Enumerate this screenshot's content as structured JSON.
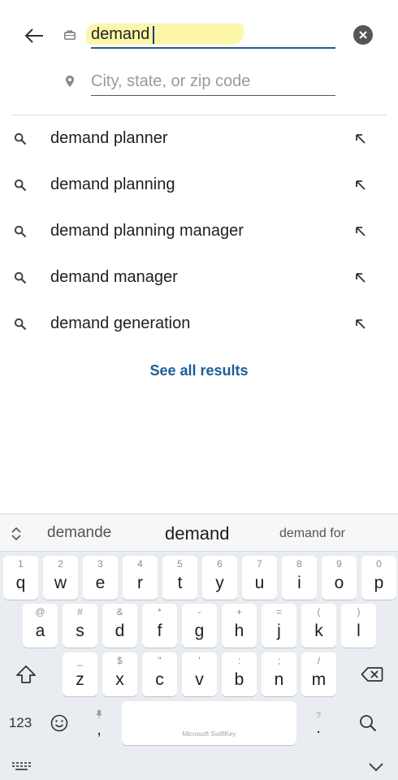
{
  "search": {
    "keyword_value": "demand",
    "location_placeholder": "City, state, or zip code"
  },
  "suggestions": [
    {
      "label": "demand planner"
    },
    {
      "label": "demand planning"
    },
    {
      "label": "demand planning manager"
    },
    {
      "label": "demand manager"
    },
    {
      "label": "demand generation"
    }
  ],
  "see_all_label": "See all results",
  "keyboard": {
    "predictions": [
      "demande",
      "demand",
      "demand for"
    ],
    "row1": [
      {
        "hint": "1",
        "ch": "q"
      },
      {
        "hint": "2",
        "ch": "w"
      },
      {
        "hint": "3",
        "ch": "e"
      },
      {
        "hint": "4",
        "ch": "r"
      },
      {
        "hint": "5",
        "ch": "t"
      },
      {
        "hint": "6",
        "ch": "y"
      },
      {
        "hint": "7",
        "ch": "u"
      },
      {
        "hint": "8",
        "ch": "i"
      },
      {
        "hint": "9",
        "ch": "o"
      },
      {
        "hint": "0",
        "ch": "p"
      }
    ],
    "row2": [
      {
        "hint": "@",
        "ch": "a"
      },
      {
        "hint": "#",
        "ch": "s"
      },
      {
        "hint": "&",
        "ch": "d"
      },
      {
        "hint": "*",
        "ch": "f"
      },
      {
        "hint": "-",
        "ch": "g"
      },
      {
        "hint": "+",
        "ch": "h"
      },
      {
        "hint": "=",
        "ch": "j"
      },
      {
        "hint": "(",
        "ch": "k"
      },
      {
        "hint": ")",
        "ch": "l"
      }
    ],
    "row3": [
      {
        "hint": "_",
        "ch": "z"
      },
      {
        "hint": "$",
        "ch": "x"
      },
      {
        "hint": "\"",
        "ch": "c"
      },
      {
        "hint": "'",
        "ch": "v"
      },
      {
        "hint": ":",
        "ch": "b"
      },
      {
        "hint": ";",
        "ch": "n"
      },
      {
        "hint": "/",
        "ch": "m"
      }
    ],
    "numbers_label": "123",
    "comma": ",",
    "period": ".",
    "comma_hint_icon": "microphone-icon",
    "period_hint": "?",
    "space_brand": "Microsoft SwiftKey"
  },
  "colors": {
    "link": "#1c5d98",
    "keyword_underline": "#2d5a8a",
    "highlight": "#fbf59a"
  }
}
